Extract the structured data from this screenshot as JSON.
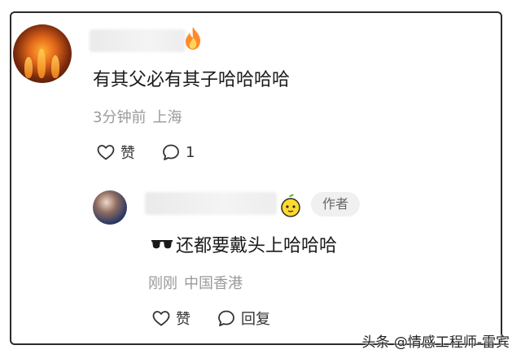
{
  "comment": {
    "text": "有其父必有其子哈哈哈哈",
    "time": "3分钟前",
    "location": "上海",
    "like_label": "赞",
    "comment_count": "1"
  },
  "reply": {
    "author_tag": "作者",
    "text": "还都要戴头上哈哈哈",
    "time": "刚刚",
    "location": "中国香港",
    "like_label": "赞",
    "reply_label": "回复"
  },
  "watermark": "头条 @情感工程师-雷宾",
  "icons": {
    "name_badge_main": "fire-icon",
    "name_badge_reply": "lemon-icon",
    "emoji_reply": "sunglasses-icon",
    "like": "heart-outline-icon",
    "comment": "speech-bubble-icon"
  }
}
